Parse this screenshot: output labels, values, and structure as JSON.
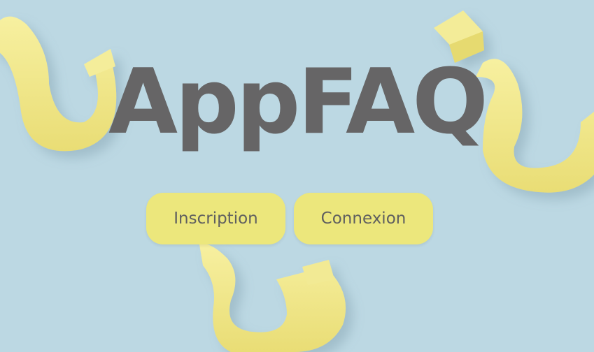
{
  "app": {
    "title": "AppFAQ"
  },
  "actions": {
    "signup_label": "Inscription",
    "login_label": "Connexion"
  },
  "colors": {
    "background": "#bcd8e3",
    "accent": "#ece77c",
    "title_text": "#666566",
    "button_text": "#5f5f5f"
  },
  "background_image": {
    "icon": "question-mark-shapes"
  }
}
